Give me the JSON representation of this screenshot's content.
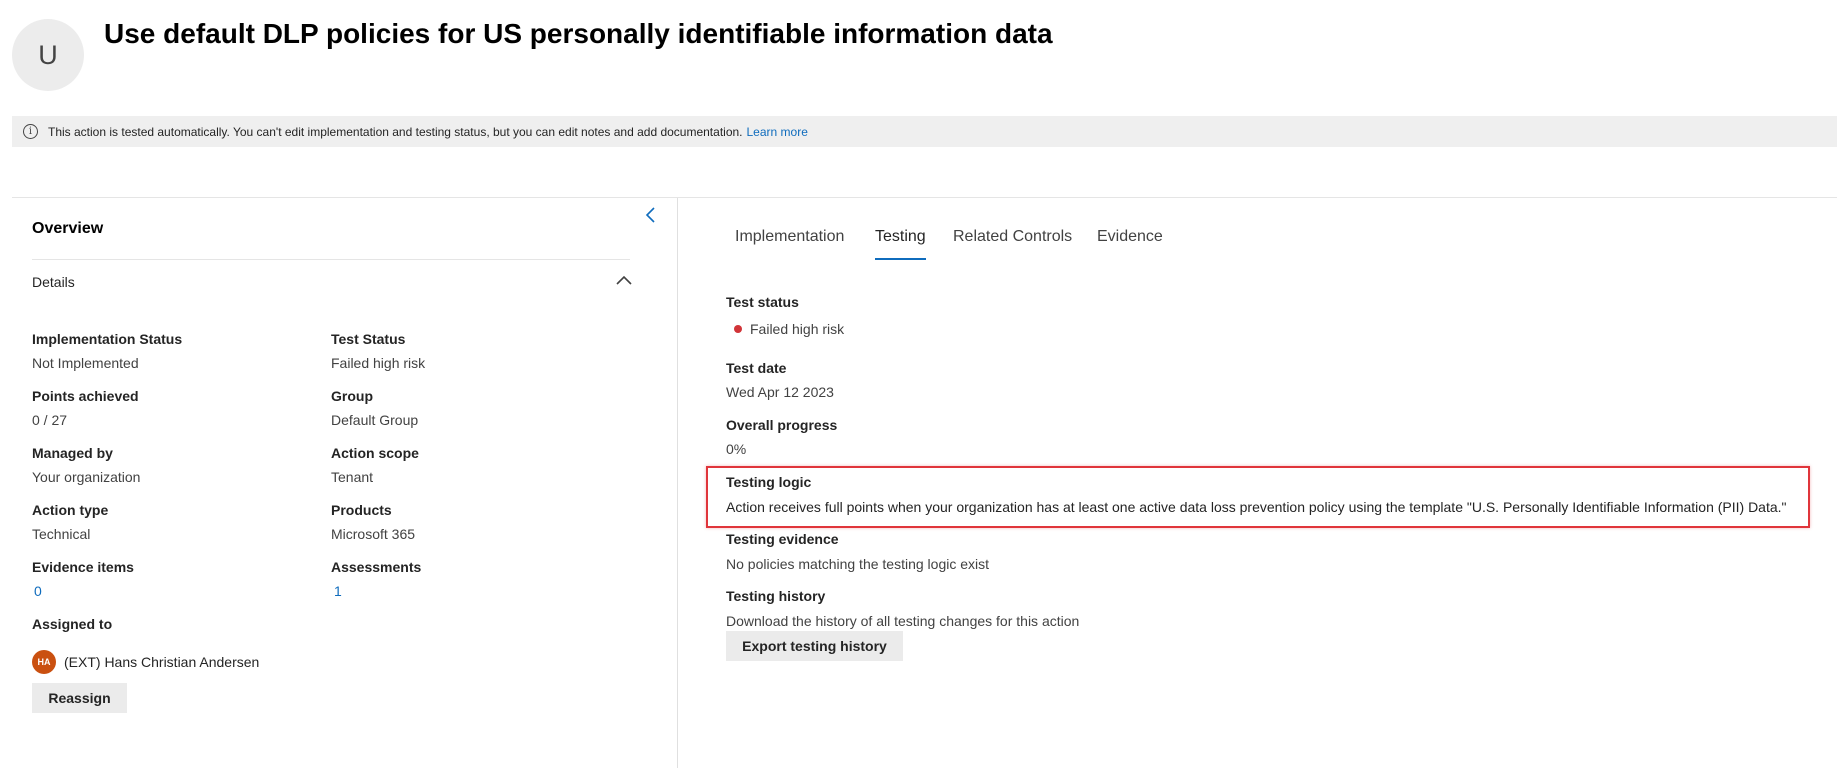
{
  "header": {
    "avatar_initial": "U",
    "title": "Use default DLP policies for US personally identifiable information data"
  },
  "banner": {
    "text": "This action is tested automatically. You can't edit implementation and testing status, but you can edit notes and add documentation.",
    "link": "Learn more"
  },
  "overview": {
    "title": "Overview",
    "details_title": "Details",
    "fields": {
      "implementation_status": {
        "label": "Implementation Status",
        "value": "Not Implemented"
      },
      "test_status": {
        "label": "Test Status",
        "value": "Failed high risk"
      },
      "points_achieved": {
        "label": "Points achieved",
        "value": "0 / 27"
      },
      "group": {
        "label": "Group",
        "value": "Default Group"
      },
      "managed_by": {
        "label": "Managed by",
        "value": "Your organization"
      },
      "action_scope": {
        "label": "Action scope",
        "value": "Tenant"
      },
      "action_type": {
        "label": "Action type",
        "value": "Technical"
      },
      "products": {
        "label": "Products",
        "value": "Microsoft 365"
      },
      "evidence_items": {
        "label": "Evidence items",
        "value": "0"
      },
      "assessments": {
        "label": "Assessments",
        "value": "1"
      }
    },
    "assigned_to": {
      "label": "Assigned to",
      "initials": "HA",
      "name": "(EXT) Hans Christian Andersen",
      "reassign_label": "Reassign"
    }
  },
  "tabs": [
    {
      "label": "Implementation",
      "active": false
    },
    {
      "label": "Testing",
      "active": true
    },
    {
      "label": "Related Controls",
      "active": false
    },
    {
      "label": "Evidence",
      "active": false
    }
  ],
  "testing": {
    "test_status": {
      "label": "Test status",
      "value": "Failed high risk",
      "status_color": "#d13438"
    },
    "test_date": {
      "label": "Test date",
      "value": "Wed Apr 12 2023"
    },
    "overall_progress": {
      "label": "Overall progress",
      "value": "0%"
    },
    "testing_logic": {
      "label": "Testing logic",
      "value": "Action receives full points when your organization has at least one active data loss prevention policy using the template \"U.S. Personally Identifiable Information (PII) Data.\""
    },
    "testing_evidence": {
      "label": "Testing evidence",
      "value": "No policies matching the testing logic exist"
    },
    "testing_history": {
      "label": "Testing history",
      "value": "Download the history of all testing changes for this action",
      "export_label": "Export testing history"
    }
  },
  "colors": {
    "accent": "#0f6cbd",
    "danger": "#d13438",
    "highlight": "#e0353b"
  }
}
